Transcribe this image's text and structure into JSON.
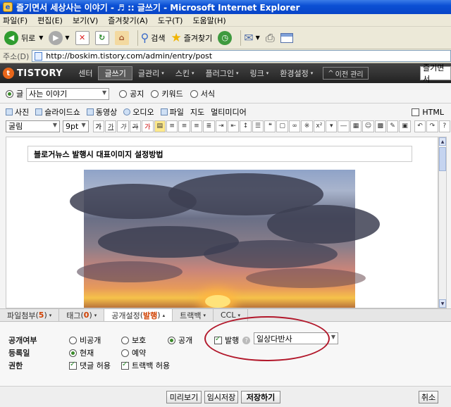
{
  "window": {
    "title": "즐기면서 세상사는 이야기 - ♬ :: 글쓰기 - Microsoft Internet Explorer",
    "logo_text": "e"
  },
  "menu": [
    "파일(F)",
    "편집(E)",
    "보기(V)",
    "즐겨찾기(A)",
    "도구(T)",
    "도움말(H)"
  ],
  "toolbar": {
    "back": "뒤로",
    "search": "검색",
    "favorites": "즐겨찾기"
  },
  "address": {
    "label": "주소(D)",
    "url": "http://boskim.tistory.com/admin/entry/post"
  },
  "tistory": {
    "logo": "TISTORY",
    "logo_mark": "t",
    "nav": [
      "센터",
      "글쓰기",
      "글관리",
      "스킨",
      "플러그인",
      "링크",
      "환경설정"
    ],
    "active_index": 1,
    "prev_admin": "이전 관리",
    "blog_name": "즐기면서"
  },
  "category": {
    "prefix": "글",
    "selected": "사는 이야기",
    "types": [
      "공지",
      "키워드",
      "서식"
    ]
  },
  "media": [
    "사진",
    "슬라이드쇼",
    "동영상",
    "오디오",
    "파일",
    "지도",
    "멀티미디어"
  ],
  "html_toggle": "HTML",
  "format": {
    "font": "굴림",
    "size": "9pt",
    "buttons": [
      "가",
      "가",
      "가",
      "가",
      "가"
    ]
  },
  "post": {
    "title": "블로거뉴스 발행시 대표이미지 설정방법"
  },
  "tabs": [
    {
      "label": "파일첨부",
      "count": "5"
    },
    {
      "label": "태그",
      "count": "0"
    },
    {
      "label": "공개설정",
      "count": "발행"
    },
    {
      "label": "트랙백",
      "count": ""
    },
    {
      "label": "CCL",
      "count": ""
    }
  ],
  "active_tab": 2,
  "visibility": {
    "label": "공개여부",
    "options": [
      "비공개",
      "보호",
      "공개"
    ],
    "selected": 2
  },
  "publish": {
    "label": "발행",
    "checked": true,
    "category": "일상다반사"
  },
  "register": {
    "label": "등록일",
    "options": [
      "현재",
      "예약"
    ],
    "selected": 0
  },
  "permission": {
    "label": "권한",
    "comment": "댓글 허용",
    "trackback": "트랙백 허용"
  },
  "buttons": {
    "preview": "미리보기",
    "temp_save": "임시저장",
    "save": "저장하기",
    "cancel": "취소"
  },
  "colors": {
    "titlebar": "#0a4fd4",
    "tistory_nav": "#333333",
    "accent_orange": "#e8661a",
    "annotation_red": "#b2182b"
  }
}
